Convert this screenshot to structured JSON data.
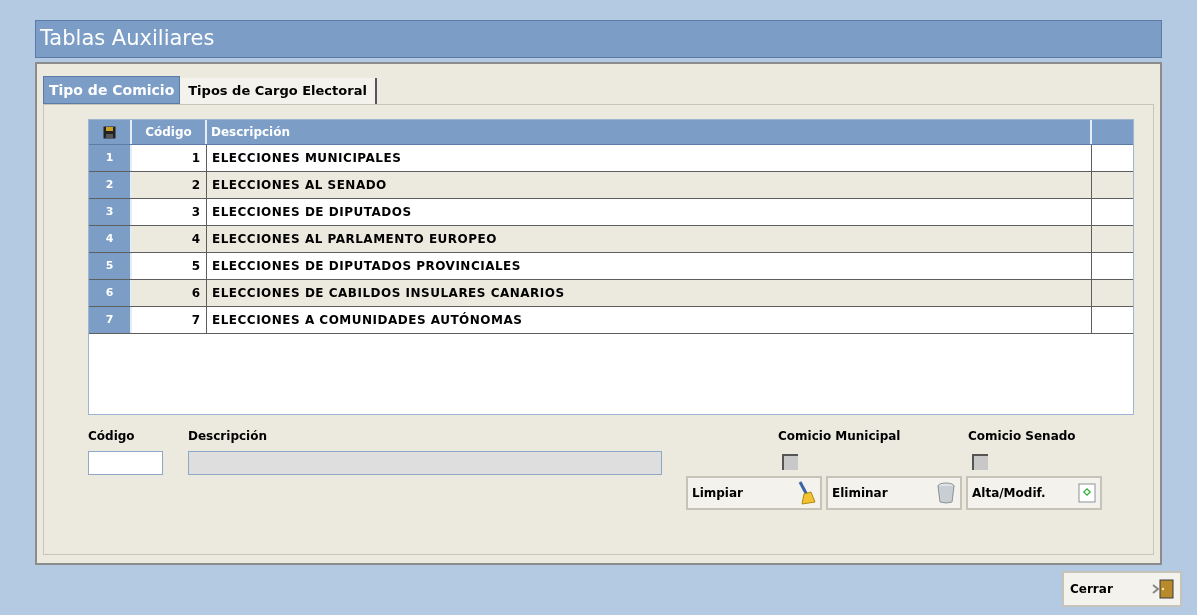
{
  "window": {
    "title": "Tablas Auxiliares"
  },
  "tabs": [
    {
      "label": "Tipo de Comicio",
      "selected": true
    },
    {
      "label": "Tipos de Cargo Electoral",
      "selected": false
    }
  ],
  "table": {
    "columns": [
      "Código",
      "Descripción"
    ],
    "rows": [
      {
        "number": "1",
        "codigo": "1",
        "descripcion": "ELECCIONES MUNICIPALES"
      },
      {
        "number": "2",
        "codigo": "2",
        "descripcion": "ELECCIONES AL SENADO"
      },
      {
        "number": "3",
        "codigo": "3",
        "descripcion": "ELECCIONES DE DIPUTADOS"
      },
      {
        "number": "4",
        "codigo": "4",
        "descripcion": "ELECCIONES AL PARLAMENTO EUROPEO"
      },
      {
        "number": "5",
        "codigo": "5",
        "descripcion": "ELECCIONES DE DIPUTADOS PROVINCIALES"
      },
      {
        "number": "6",
        "codigo": "6",
        "descripcion": "ELECCIONES DE CABILDOS INSULARES CANARIOS"
      },
      {
        "number": "7",
        "codigo": "7",
        "descripcion": "ELECCIONES A COMUNIDADES AUTÓNOMAS"
      }
    ]
  },
  "form": {
    "fields": [
      {
        "label": "Código",
        "disabled": false
      },
      {
        "label": "Descripción",
        "disabled": true
      }
    ],
    "checkboxes": [
      {
        "label": "Comicio Municipal",
        "checked": false,
        "disabled": true
      },
      {
        "label": "Comicio Senado",
        "checked": false,
        "disabled": true
      }
    ]
  },
  "buttons": [
    {
      "label": "Limpiar",
      "kind": "broom"
    },
    {
      "label": "Eliminar",
      "kind": "trash"
    },
    {
      "label": "Alta/Modif.",
      "kind": "add"
    }
  ],
  "close_button": {
    "label": "Cerrar"
  }
}
